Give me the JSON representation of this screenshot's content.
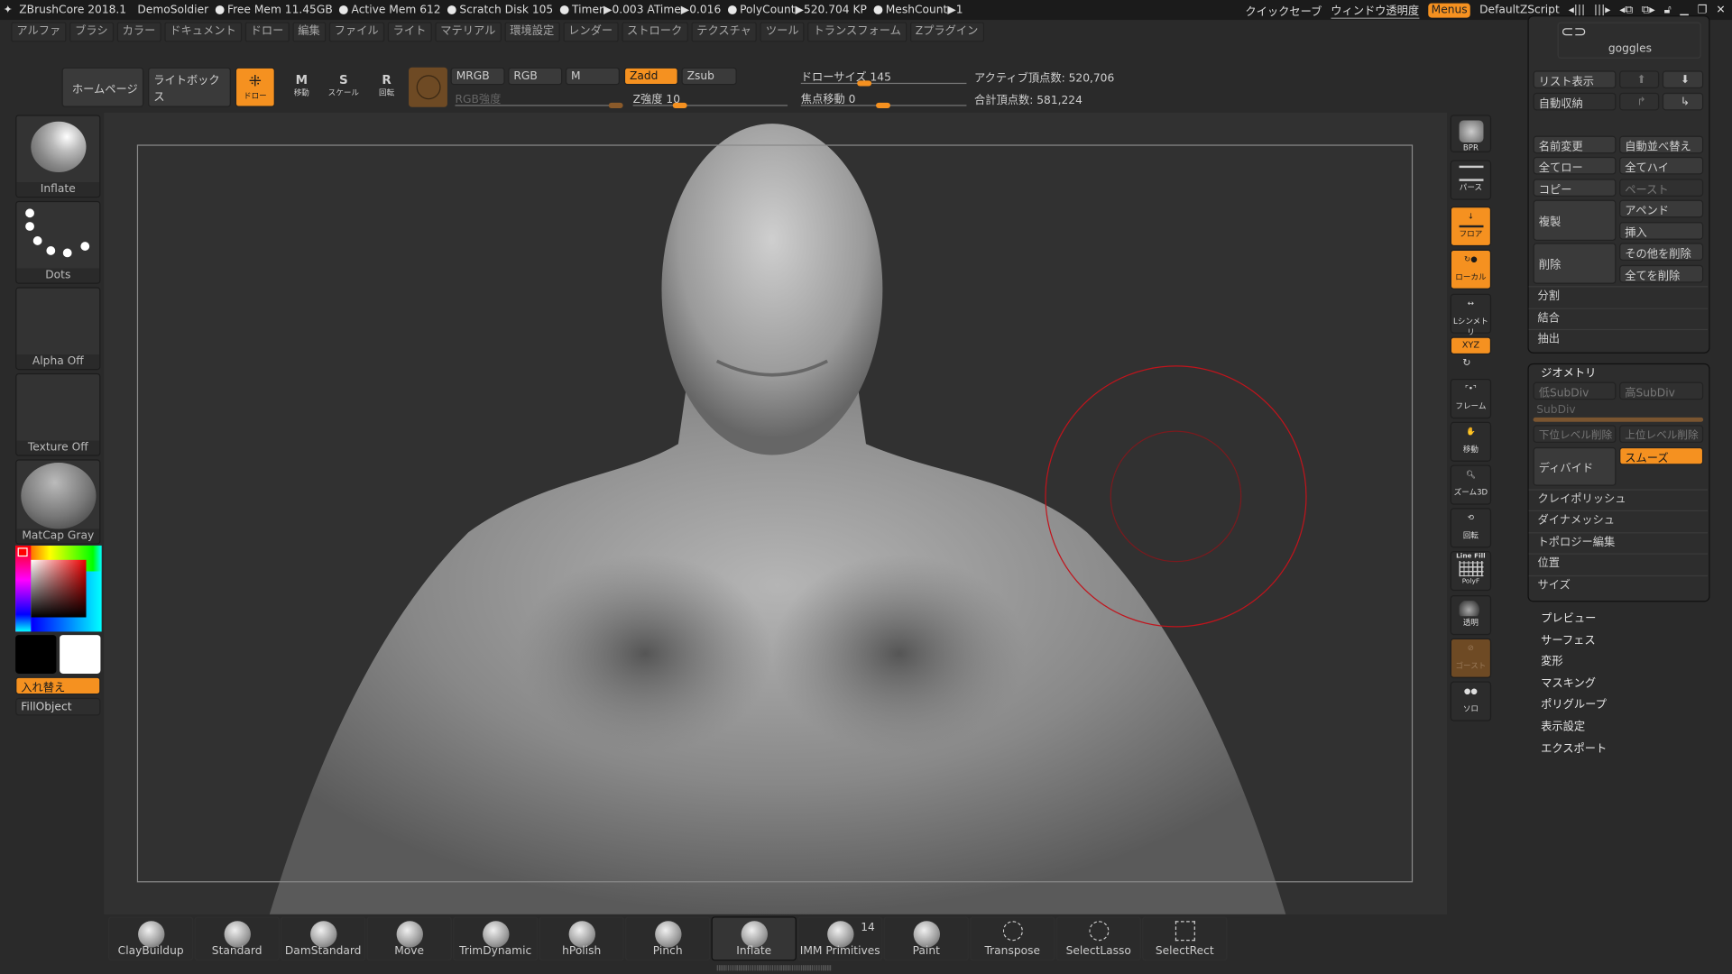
{
  "app": {
    "title": "ZBrushCore 2018.1",
    "project": "DemoSoldier"
  },
  "status": {
    "free_mem": "Free Mem 11.45GB",
    "active_mem": "Active Mem 612",
    "scratch": "Scratch Disk 105",
    "timer": "Timer▶0.003 ATime▶0.016",
    "polycount": "PolyCount▶520.704 KP",
    "meshcount": "MeshCount▶1"
  },
  "topright": {
    "quicksave": "クイックセーブ",
    "transparency": "ウィンドウ透明度",
    "menus": "Menus",
    "zscript": "DefaultZScript"
  },
  "menu": [
    "アルファ",
    "ブラシ",
    "カラー",
    "ドキュメント",
    "ドロー",
    "編集",
    "ファイル",
    "ライト",
    "マテリアル",
    "環境設定",
    "レンダー",
    "ストローク",
    "テクスチャ",
    "ツール",
    "トランスフォーム",
    "Zプラグイン"
  ],
  "toolbar": {
    "home": "ホームページ",
    "lightbox": "ライトボックス",
    "draw": "ドロー",
    "move": "移動",
    "scale": "スケール",
    "rotate": "回転",
    "mrgb": "MRGB",
    "rgb": "RGB",
    "m": "M",
    "zadd": "Zadd",
    "zsub": "Zsub",
    "rgb_intensity": "RGB強度",
    "z_intensity": "Z強度 10",
    "draw_size": "ドローサイズ 145",
    "focal_shift": "焦点移動 0",
    "active_points": "アクティブ頂点数: 520,706",
    "total_points": "合計頂点数: 581,224",
    "z_intensity_value": 10,
    "draw_size_value": 145,
    "focal_shift_value": 0
  },
  "left": {
    "brush": "Inflate",
    "stroke": "Dots",
    "alpha": "Alpha Off",
    "texture": "Texture Off",
    "material": "MatCap Gray",
    "swap": "入れ替え",
    "fill": "FillObject",
    "main_color": "#ff0000",
    "secondary_color": "#ffffff"
  },
  "shelf": {
    "bpr": "BPR",
    "persp": "パース",
    "floor": "フロア",
    "local": "ローカル",
    "symmetry": "Lシンメトリ",
    "xyz": "XYZ",
    "frame": "フレーム",
    "move": "移動",
    "zoom": "ズーム3D",
    "rotate": "回転",
    "linefill": "Line Fill",
    "polyf": "PolyF",
    "transp": "透明",
    "ghost": "ゴースト",
    "solo": "ソロ"
  },
  "subtool": {
    "name": "goggles",
    "list": "リスト表示",
    "autocollapse": "自動収納",
    "rename": "名前変更",
    "autoreorder": "自動並べ替え",
    "all_low": "全てロー",
    "all_high": "全てハイ",
    "copy": "コピー",
    "paste": "ペースト",
    "duplicate": "複製",
    "append": "アペンド",
    "insert": "挿入",
    "delete": "削除",
    "del_other": "その他を削除",
    "del_all": "全てを削除",
    "split": "分割",
    "merge": "結合",
    "extract": "抽出"
  },
  "geometry": {
    "title": "ジオメトリ",
    "lower": "低SubDiv",
    "higher": "高SubDiv",
    "subdiv": "SubDiv",
    "del_lower": "下位レベル削除",
    "del_higher": "上位レベル削除",
    "divide": "ディバイド",
    "smooth": "スムーズ",
    "claypolish": "クレイポリッシュ",
    "dynamesh": "ダイナメッシュ",
    "topology": "トポロジー編集",
    "position": "位置",
    "size": "サイズ"
  },
  "tool_sections": [
    "プレビュー",
    "サーフェス",
    "変形",
    "マスキング",
    "ポリグループ",
    "表示設定",
    "エクスポート"
  ],
  "brushes": [
    {
      "label": "ClayBuildup"
    },
    {
      "label": "Standard"
    },
    {
      "label": "DamStandard"
    },
    {
      "label": "Move"
    },
    {
      "label": "TrimDynamic"
    },
    {
      "label": "hPolish"
    },
    {
      "label": "Pinch"
    },
    {
      "label": "Inflate",
      "active": true
    },
    {
      "label": "IMM Primitives",
      "count": "14"
    },
    {
      "label": "Paint"
    },
    {
      "label": "Transpose"
    },
    {
      "label": "SelectLasso"
    },
    {
      "label": "SelectRect"
    }
  ],
  "colors": {
    "accent": "#f59120",
    "cursor": "#c0141c"
  }
}
